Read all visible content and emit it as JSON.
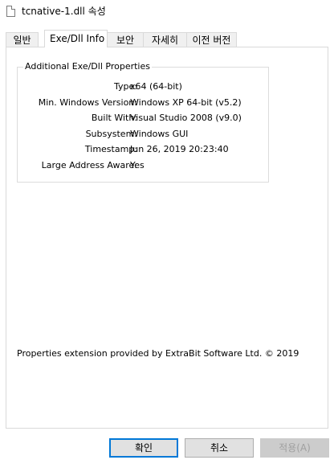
{
  "window": {
    "title": "tcnative-1.dll 속성"
  },
  "tabs": [
    {
      "label": "일반"
    },
    {
      "label": "Exe/Dll Info"
    },
    {
      "label": "보안"
    },
    {
      "label": "자세히"
    },
    {
      "label": "이전 버전"
    }
  ],
  "group": {
    "title": "Additional Exe/Dll Properties",
    "rows": [
      {
        "label": "Type:",
        "value": "x64 (64-bit)"
      },
      {
        "label": "Min. Windows Version:",
        "value": "Windows XP 64-bit (v5.2)"
      },
      {
        "label": "Built With:",
        "value": "Visual Studio 2008 (v9.0)"
      },
      {
        "label": "Subsystem:",
        "value": "Windows GUI"
      },
      {
        "label": "Timestamp:",
        "value": "Jun 26, 2019 20:23:40"
      },
      {
        "label": "Large Address Aware:",
        "value": "Yes"
      }
    ]
  },
  "footer": {
    "text": "Properties extension provided by ExtraBit Software Ltd. © 2019"
  },
  "buttons": {
    "ok": "확인",
    "cancel": "취소",
    "apply": "적용(A)"
  }
}
